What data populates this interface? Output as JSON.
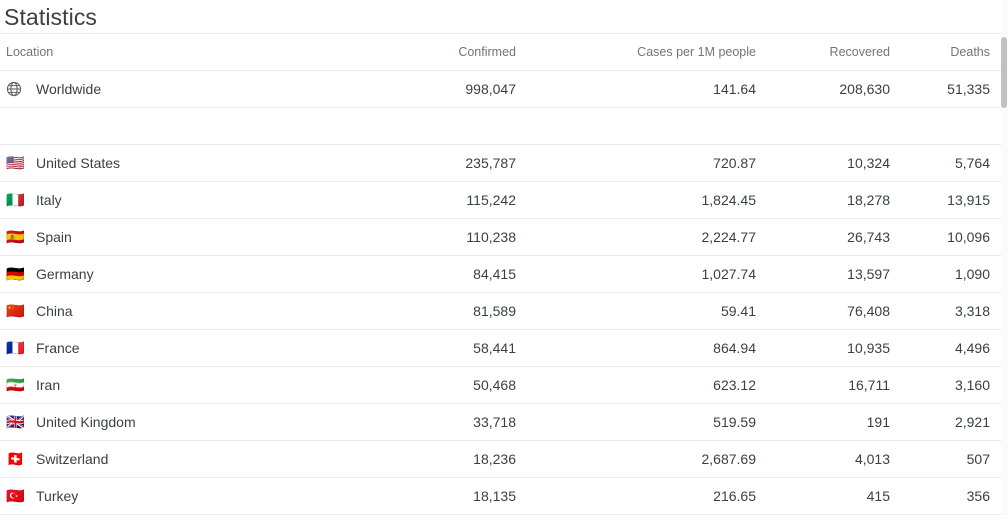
{
  "page": {
    "title": "Statistics"
  },
  "table": {
    "columns": [
      {
        "key": "location",
        "label": "Location",
        "align": "left"
      },
      {
        "key": "confirmed",
        "label": "Confirmed",
        "align": "right"
      },
      {
        "key": "permil",
        "label": "Cases per 1M people",
        "align": "right"
      },
      {
        "key": "recovered",
        "label": "Recovered",
        "align": "right"
      },
      {
        "key": "deaths",
        "label": "Deaths",
        "align": "right"
      }
    ],
    "summary_row": {
      "icon": "globe-icon",
      "location": "Worldwide",
      "confirmed": "998,047",
      "permil": "141.64",
      "recovered": "208,630",
      "deaths": "51,335"
    },
    "rows": [
      {
        "flag": "🇺🇸",
        "flag_name": "flag-united-states",
        "location": "United States",
        "confirmed": "235,787",
        "permil": "720.87",
        "recovered": "10,324",
        "deaths": "5,764"
      },
      {
        "flag": "🇮🇹",
        "flag_name": "flag-italy",
        "location": "Italy",
        "confirmed": "115,242",
        "permil": "1,824.45",
        "recovered": "18,278",
        "deaths": "13,915"
      },
      {
        "flag": "🇪🇸",
        "flag_name": "flag-spain",
        "location": "Spain",
        "confirmed": "110,238",
        "permil": "2,224.77",
        "recovered": "26,743",
        "deaths": "10,096"
      },
      {
        "flag": "🇩🇪",
        "flag_name": "flag-germany",
        "location": "Germany",
        "confirmed": "84,415",
        "permil": "1,027.74",
        "recovered": "13,597",
        "deaths": "1,090"
      },
      {
        "flag": "🇨🇳",
        "flag_name": "flag-china",
        "location": "China",
        "confirmed": "81,589",
        "permil": "59.41",
        "recovered": "76,408",
        "deaths": "3,318"
      },
      {
        "flag": "🇫🇷",
        "flag_name": "flag-france",
        "location": "France",
        "confirmed": "58,441",
        "permil": "864.94",
        "recovered": "10,935",
        "deaths": "4,496"
      },
      {
        "flag": "🇮🇷",
        "flag_name": "flag-iran",
        "location": "Iran",
        "confirmed": "50,468",
        "permil": "623.12",
        "recovered": "16,711",
        "deaths": "3,160"
      },
      {
        "flag": "🇬🇧",
        "flag_name": "flag-united-kingdom",
        "location": "United Kingdom",
        "confirmed": "33,718",
        "permil": "519.59",
        "recovered": "191",
        "deaths": "2,921"
      },
      {
        "flag": "🇨🇭",
        "flag_name": "flag-switzerland",
        "location": "Switzerland",
        "confirmed": "18,236",
        "permil": "2,687.69",
        "recovered": "4,013",
        "deaths": "507"
      },
      {
        "flag": "🇹🇷",
        "flag_name": "flag-turkey",
        "location": "Turkey",
        "confirmed": "18,135",
        "permil": "216.65",
        "recovered": "415",
        "deaths": "356"
      }
    ]
  },
  "colors": {
    "text_primary": "#3c4043",
    "text_muted": "#70757a",
    "border": "#e8eaed",
    "background": "#ffffff",
    "scrollbar_thumb": "#c1c1c1"
  }
}
